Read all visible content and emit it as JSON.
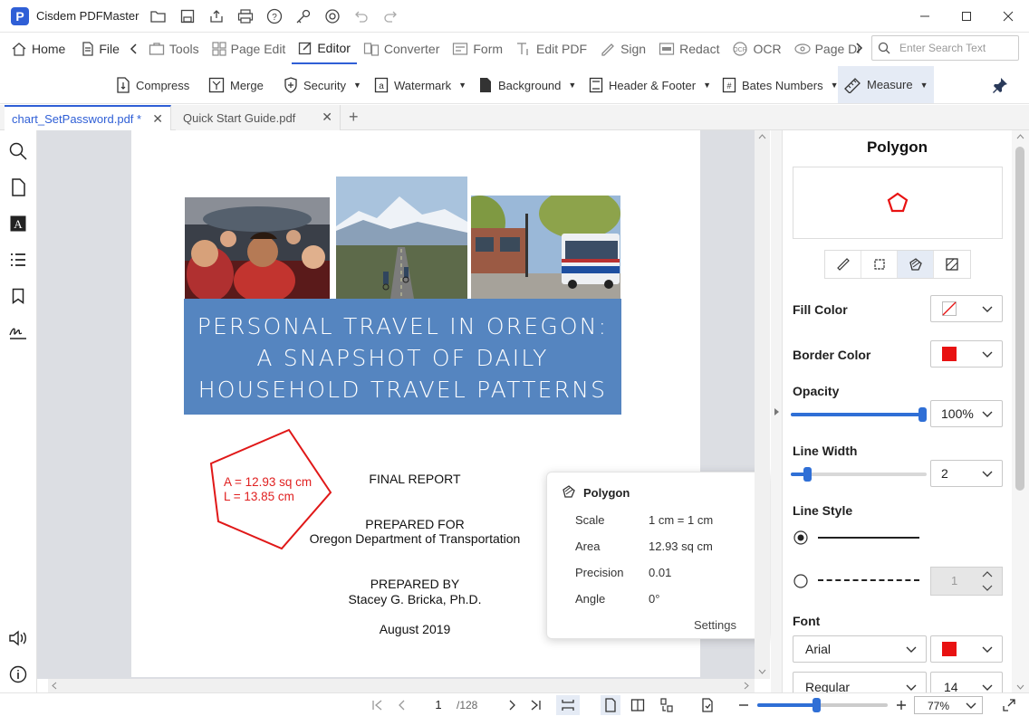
{
  "app": {
    "logo": "P",
    "title": "Cisdem PDFMaster"
  },
  "menu": {
    "items": [
      {
        "label": "Home",
        "icon": "home-icon"
      },
      {
        "label": "File",
        "icon": "file-icon"
      },
      {
        "label": "Tools",
        "icon": "tools-icon"
      },
      {
        "label": "Page Edit",
        "icon": "page-edit-icon"
      },
      {
        "label": "Editor",
        "icon": "editor-icon"
      },
      {
        "label": "Converter",
        "icon": "converter-icon"
      },
      {
        "label": "Form",
        "icon": "form-icon"
      },
      {
        "label": "Edit PDF",
        "icon": "edit-pdf-icon"
      },
      {
        "label": "Sign",
        "icon": "sign-icon"
      },
      {
        "label": "Redact",
        "icon": "redact-icon"
      },
      {
        "label": "OCR",
        "icon": "ocr-icon"
      },
      {
        "label": "Page Di",
        "icon": "page-display-icon"
      }
    ],
    "search_placeholder": "Enter Search Text"
  },
  "toolbar": {
    "compress": "Compress",
    "merge": "Merge",
    "security": "Security",
    "watermark": "Watermark",
    "background": "Background",
    "header_footer": "Header & Footer",
    "bates": "Bates Numbers",
    "measure": "Measure"
  },
  "tabs": [
    {
      "label": "chart_SetPassword.pdf *",
      "active": true
    },
    {
      "label": "Quick Start Guide.pdf",
      "active": false
    }
  ],
  "document": {
    "banner": [
      "PERSONAL TRAVEL IN OREGON:",
      "A SNAPSHOT OF DAILY",
      "HOUSEHOLD TRAVEL PATTERNS"
    ],
    "final_report": "FINAL REPORT",
    "prepared_for": "PREPARED FOR",
    "prepared_for_org": "Oregon Department of Transportation",
    "prepared_by": "PREPARED BY",
    "prepared_by_name": "Stacey G. Bricka, Ph.D.",
    "date": "August 2019",
    "measure_area": "A = 12.93 sq cm",
    "measure_length": "L = 13.85 cm"
  },
  "popup": {
    "title": "Polygon",
    "rows": [
      {
        "label": "Scale",
        "value": "1 cm = 1 cm"
      },
      {
        "label": "Area",
        "value": "12.93 sq cm"
      },
      {
        "label": "Precision",
        "value": "0.01"
      },
      {
        "label": "Angle",
        "value": "0°"
      }
    ],
    "settings": "Settings"
  },
  "panel": {
    "title": "Polygon",
    "fill_color_label": "Fill Color",
    "border_color_label": "Border Color",
    "opacity_label": "Opacity",
    "opacity_value": "100%",
    "opacity_level": 1.0,
    "line_width_label": "Line Width",
    "line_width_value": "2",
    "line_width_level": 0.1,
    "line_style_label": "Line Style",
    "dash_value": "1",
    "font_label": "Font",
    "font_family": "Arial",
    "font_style": "Regular",
    "font_size": "14",
    "border_color": "#e81212",
    "accent": "#2f5fd6"
  },
  "status": {
    "page_current": "1",
    "page_total": "/128",
    "zoom": "77%",
    "zoom_level": 0.45
  }
}
